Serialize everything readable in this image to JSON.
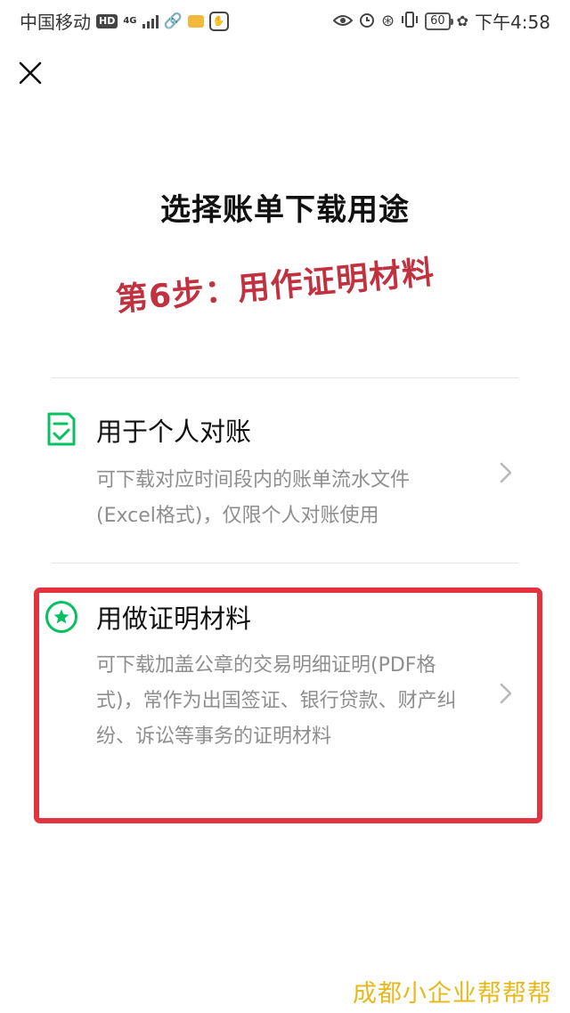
{
  "status_bar": {
    "carrier": "中国移动",
    "hd_badge": "HD",
    "network": "4G",
    "battery": "60",
    "time": "下午4:58"
  },
  "header": {
    "title": "选择账单下载用途"
  },
  "annotation": {
    "step_text": "第6步：用作证明材料"
  },
  "options": [
    {
      "title": "用于个人对账",
      "desc": "可下载对应时间段内的账单流水文件(Excel格式)，仅限个人对账使用",
      "icon": "checklist-icon"
    },
    {
      "title": "用做证明材料",
      "desc": "可下载加盖公章的交易明细证明(PDF格式)，常作为出国签证、银行贷款、财产纠纷、诉讼等事务的证明材料",
      "icon": "star-badge-icon"
    }
  ],
  "watermark": "成都小企业帮帮帮",
  "colors": {
    "brand_green": "#07c160",
    "highlight_red": "#e2333f",
    "annotation_red": "#c0323f",
    "watermark_yellow": "#e6b91e"
  }
}
